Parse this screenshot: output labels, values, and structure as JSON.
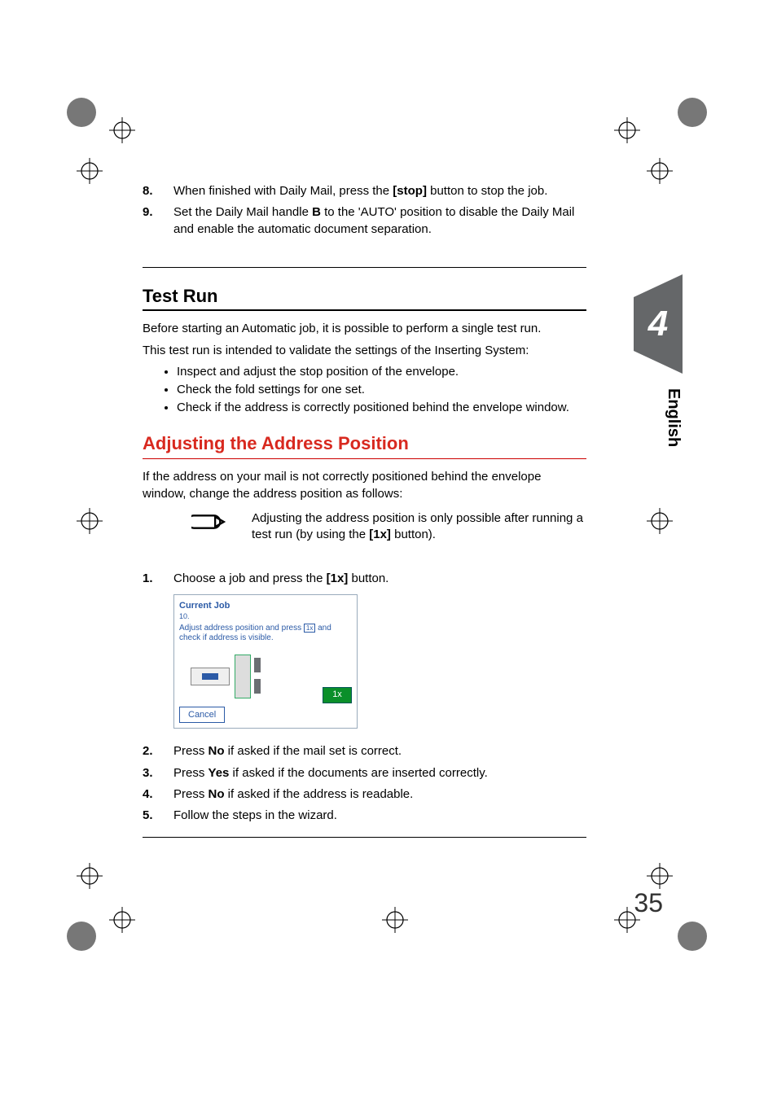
{
  "chapter_tab": {
    "number": "4",
    "language": "English"
  },
  "page_number": "35",
  "top_list": [
    {
      "n": "8.",
      "text_a": "When finished with Daily Mail, press the ",
      "bold_a": "[stop]",
      "text_b": " button to stop the job."
    },
    {
      "n": "9.",
      "text_a": "Set the Daily Mail handle ",
      "bold_a": "B",
      "text_b": " to the 'AUTO' position to disable the Daily Mail and enable the automatic document separation."
    }
  ],
  "h_testrun": "Test Run",
  "testrun_intro1": "Before starting an Automatic job, it is possible to perform a single test run.",
  "testrun_intro2": "This test run is intended to validate the settings of the Inserting System:",
  "testrun_bullets": [
    "Inspect and adjust the stop position of the envelope.",
    "Check the fold settings for one set.",
    "Check if the address is correctly positioned behind the envelope window."
  ],
  "h_adjust": "Adjusting the Address Position",
  "adjust_intro": "If the address on your mail is not correctly positioned behind the envelope window, change the address position as follows:",
  "note": {
    "a": "Adjusting the address position is only possible after running a test run (by using the ",
    "bold": "[1x]",
    "b": " button)."
  },
  "step1": {
    "n": "1.",
    "a": "Choose a job and press the ",
    "bold": "[1x]",
    "b": " button."
  },
  "screenshot": {
    "title": "Current Job",
    "subtitle": "10.",
    "instruction_a": "Adjust address position and press ",
    "instruction_icon": "1x",
    "instruction_b": " and check if address is visible.",
    "button_1x": "1x",
    "button_cancel": "Cancel"
  },
  "lower_list": [
    {
      "n": "2.",
      "a": "Press ",
      "bold": "No",
      "b": " if asked if the mail set is correct."
    },
    {
      "n": "3.",
      "a": "Press ",
      "bold": "Yes",
      "b": " if asked if the documents are inserted correctly."
    },
    {
      "n": "4.",
      "a": "Press ",
      "bold": "No",
      "b": " if asked if the address is readable."
    },
    {
      "n": "5.",
      "a": "Follow the steps in the wizard.",
      "bold": "",
      "b": ""
    }
  ]
}
